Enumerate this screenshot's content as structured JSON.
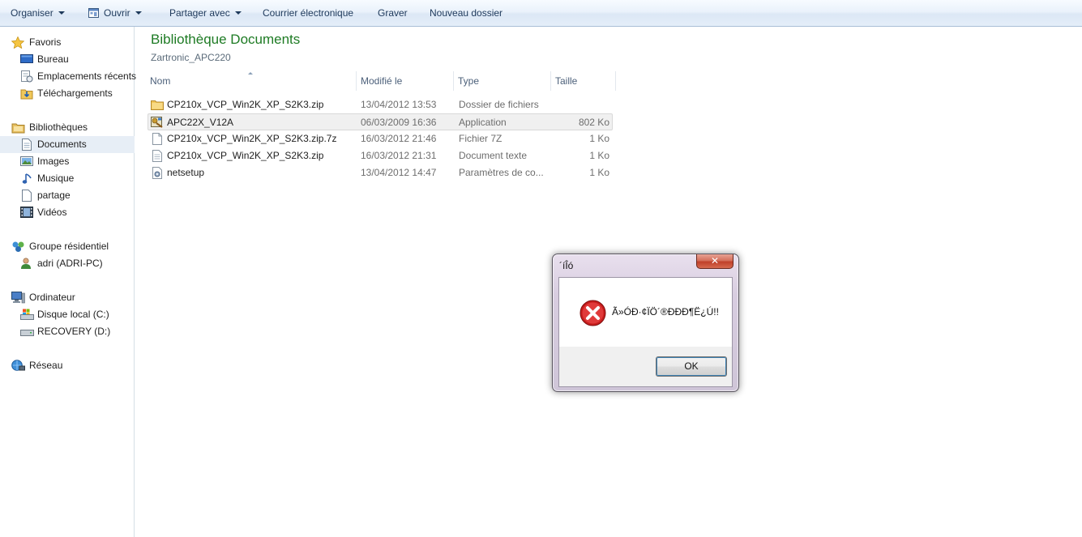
{
  "toolbar": {
    "organize": "Organiser",
    "open": "Ouvrir",
    "share": "Partager avec",
    "email": "Courrier électronique",
    "burn": "Graver",
    "new_folder": "Nouveau dossier"
  },
  "nav": {
    "favorites": "Favoris",
    "desktop": "Bureau",
    "recent": "Emplacements récents",
    "downloads": "Téléchargements",
    "libraries": "Bibliothèques",
    "documents": "Documents",
    "images": "Images",
    "music": "Musique",
    "share": "partage",
    "videos": "Vidéos",
    "homegroup": "Groupe résidentiel",
    "user": "adri (ADRI-PC)",
    "computer": "Ordinateur",
    "disk_c": "Disque local (C:)",
    "disk_d": "RECOVERY (D:)",
    "network": "Réseau"
  },
  "library": {
    "title": "Bibliothèque Documents",
    "subtitle": "Zartronic_APC220"
  },
  "columns": {
    "name": "Nom",
    "modified": "Modifié le",
    "type": "Type",
    "size": "Taille"
  },
  "files": [
    {
      "name": "CP210x_VCP_Win2K_XP_S2K3.zip",
      "modified": "13/04/2012 13:53",
      "type": "Dossier de fichiers",
      "size": "",
      "icon": "folder-icon"
    },
    {
      "name": "APC22X_V12A",
      "modified": "06/03/2009 16:36",
      "type": "Application",
      "size": "802 Ko",
      "icon": "application-icon"
    },
    {
      "name": "CP210x_VCP_Win2K_XP_S2K3.zip.7z",
      "modified": "16/03/2012 21:46",
      "type": "Fichier 7Z",
      "size": "1 Ko",
      "icon": "file-icon"
    },
    {
      "name": "CP210x_VCP_Win2K_XP_S2K3.zip",
      "modified": "16/03/2012 21:31",
      "type": "Document texte",
      "size": "1 Ko",
      "icon": "text-file-icon"
    },
    {
      "name": "netsetup",
      "modified": "13/04/2012 14:47",
      "type": "Paramètres de co...",
      "size": "1 Ko",
      "icon": "settings-file-icon"
    }
  ],
  "dialog": {
    "title": "´íÎó",
    "close": "✕",
    "message": "Ã»ÓÐ·¢ÏÖ´®ÐÐÐ¶Ë¿Ú!!",
    "ok": "OK",
    "icon": "error-icon"
  }
}
